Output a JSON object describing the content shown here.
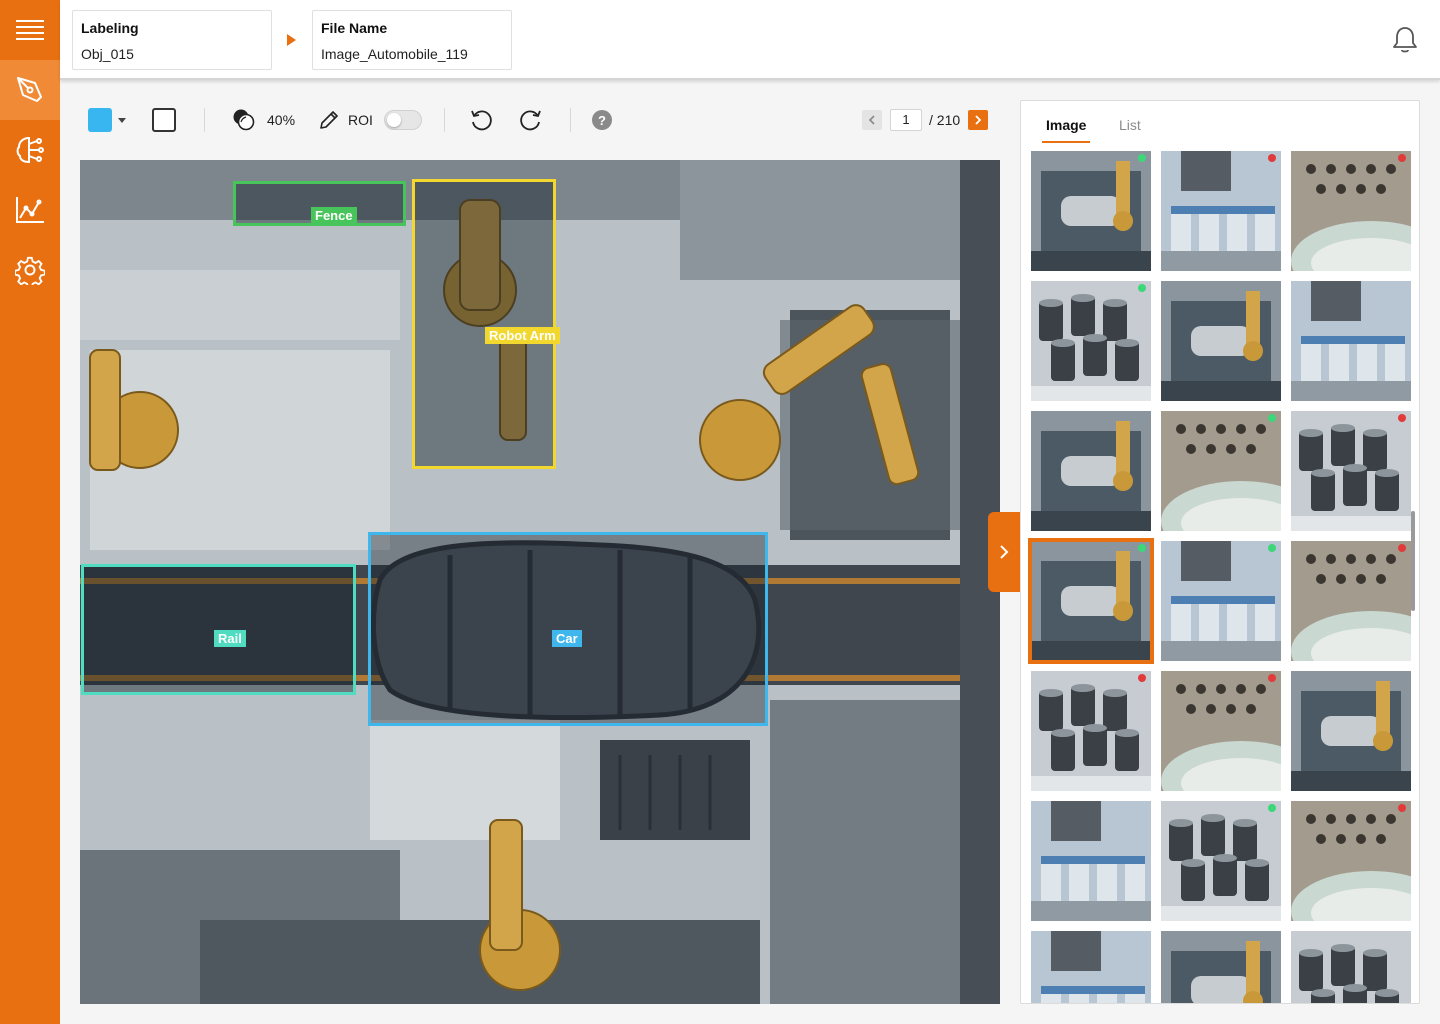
{
  "sidebar": {
    "menu_icon": "hamburger-menu-icon",
    "items": [
      {
        "icon": "pen-tool-icon",
        "active": true
      },
      {
        "icon": "brain-network-icon",
        "active": false
      },
      {
        "icon": "line-chart-icon",
        "active": false
      },
      {
        "icon": "gear-icon",
        "active": false
      }
    ]
  },
  "header": {
    "labeling": {
      "label": "Labeling",
      "value": "Obj_015"
    },
    "file": {
      "label": "File Name",
      "value": "Image_Automobile_119"
    },
    "bell_icon": "bell-icon"
  },
  "toolbar": {
    "color": "#38b6f0",
    "opacity": "40%",
    "roi_label": "ROI",
    "roi_enabled": false,
    "help": "?",
    "page_current": "1",
    "page_total": "/ 210"
  },
  "annotations": [
    {
      "label": "Fence",
      "color": "#47c45a"
    },
    {
      "label": "Robot Arm",
      "color": "#f2d72e"
    },
    {
      "label": "Rail",
      "color": "#4fdcc0"
    },
    {
      "label": "Car",
      "color": "#3fb6ec"
    }
  ],
  "panel": {
    "tabs": [
      {
        "label": "Image",
        "active": true
      },
      {
        "label": "List",
        "active": false
      }
    ],
    "thumbnails": [
      {
        "kind": "robot",
        "status": "#3cd778"
      },
      {
        "kind": "vials",
        "status": "#e23a3a"
      },
      {
        "kind": "pills",
        "status": "#e23a3a"
      },
      {
        "kind": "cans",
        "status": "#3cd778"
      },
      {
        "kind": "robot",
        "status": ""
      },
      {
        "kind": "vials",
        "status": ""
      },
      {
        "kind": "robot",
        "status": ""
      },
      {
        "kind": "pills",
        "status": "#3cd778"
      },
      {
        "kind": "cans",
        "status": "#e23a3a"
      },
      {
        "kind": "robot",
        "status": "#3cd778",
        "selected": true
      },
      {
        "kind": "vials",
        "status": "#3cd778"
      },
      {
        "kind": "pills",
        "status": "#e23a3a"
      },
      {
        "kind": "cans",
        "status": "#e23a3a"
      },
      {
        "kind": "pills",
        "status": "#e23a3a"
      },
      {
        "kind": "robot",
        "status": ""
      },
      {
        "kind": "vials",
        "status": ""
      },
      {
        "kind": "cans",
        "status": "#3cd778"
      },
      {
        "kind": "pills",
        "status": "#e23a3a"
      },
      {
        "kind": "vials",
        "status": ""
      },
      {
        "kind": "robot",
        "status": ""
      },
      {
        "kind": "cans",
        "status": ""
      }
    ]
  }
}
